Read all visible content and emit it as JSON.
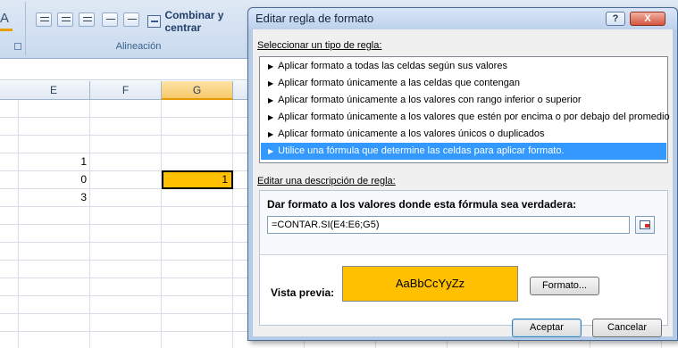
{
  "ribbon": {
    "partial_label": "Combinar y centrar",
    "group_label": "Alineación"
  },
  "sheet": {
    "columns": [
      "E",
      "F",
      "G"
    ],
    "cells": {
      "e3": "1",
      "e4": "0",
      "e5": "3",
      "g4": "1"
    }
  },
  "dialog": {
    "title": "Editar regla de formato",
    "help": "?",
    "close": "X",
    "select_type_label": "Seleccionar un tipo de regla:",
    "rule_types": [
      "Aplicar formato a todas las celdas según sus valores",
      "Aplicar formato únicamente a las celdas que contengan",
      "Aplicar formato únicamente a los valores con rango inferior o superior",
      "Aplicar formato únicamente a los valores que estén por encima o por debajo del promedio",
      "Aplicar formato únicamente a los valores únicos o duplicados",
      "Utilice una fórmula que determine las celdas para aplicar formato."
    ],
    "selected_index": 5,
    "edit_description_label": "Editar una descripción de regla:",
    "formula_heading": "Dar formato a los valores donde esta fórmula sea verdadera:",
    "formula_value": "=CONTAR.SI(E4:E6;G5)",
    "preview_label": "Vista previa:",
    "preview_text": "AaBbCcYyZz",
    "preview_fill": "#ffc000",
    "format_button": "Formato...",
    "accept_button": "Aceptar",
    "cancel_button": "Cancelar"
  }
}
